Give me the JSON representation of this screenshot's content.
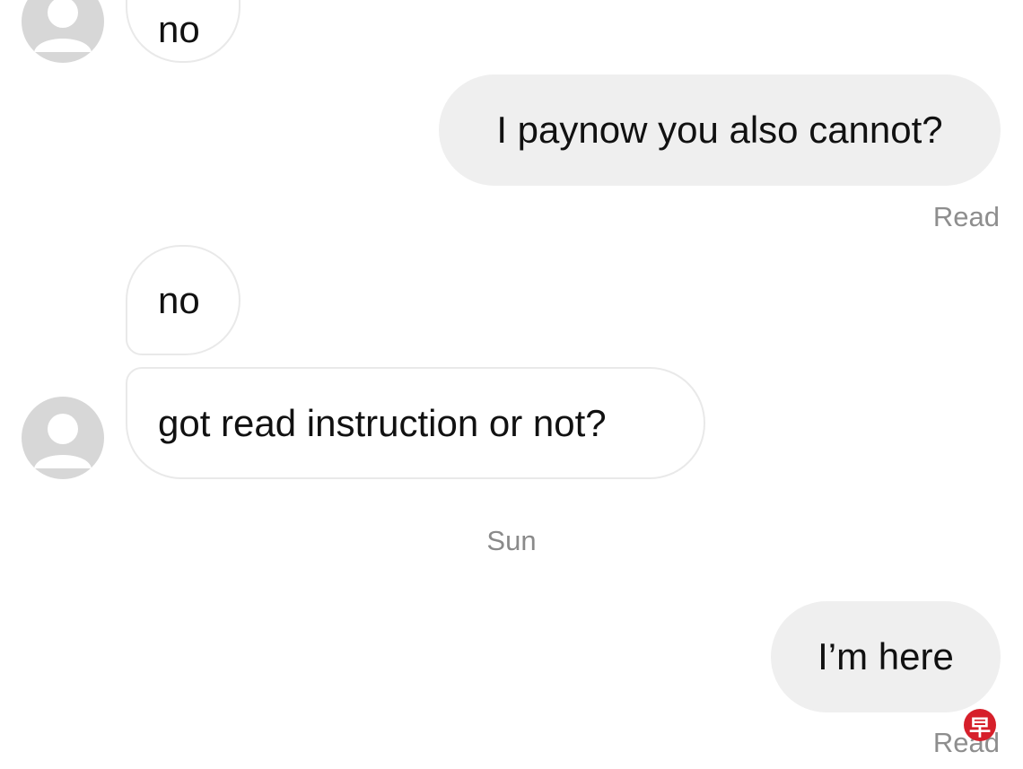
{
  "messages": {
    "m1_text": "no",
    "m2_text": "I paynow you also cannot?",
    "m2_receipt": "Read",
    "m3_text": "no",
    "m4_text": "got read instruction or not?",
    "day_separator": "Sun",
    "m5_text": "I’m here",
    "m5_receipt": "Read"
  },
  "watermark": {
    "glyph": "早"
  },
  "colors": {
    "avatar": "#d7d7d7",
    "outgoing_bubble": "#efefef",
    "incoming_border": "#e9e9e9",
    "meta_text": "#8e8e8e",
    "watermark": "#d61f2a"
  },
  "icons": {
    "avatar": "default-user-avatar-icon"
  }
}
